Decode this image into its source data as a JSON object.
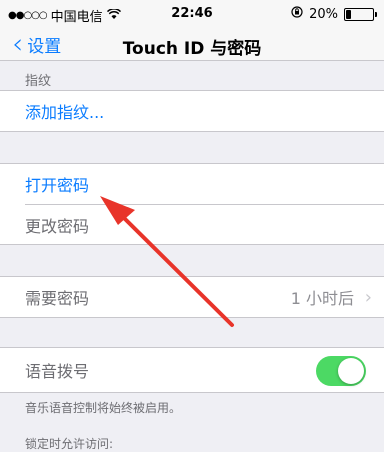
{
  "status_bar": {
    "signal": "●●○○○",
    "carrier": "中国电信",
    "wifi_icon": "wifi-icon",
    "time": "22:46",
    "battery": "20%",
    "battery_level": 0.2
  },
  "nav": {
    "back_label": "设置",
    "title": "Touch ID 与密码"
  },
  "sections": {
    "fingerprint_header": "指纹",
    "add_fingerprint": "添加指纹...",
    "turn_on_passcode": "打开密码",
    "change_passcode": "更改密码",
    "require_passcode": "需要密码",
    "require_passcode_value": "1 小时后",
    "voice_dial": "语音拨号",
    "voice_dial_on": true,
    "voice_dial_footer": "音乐语音控制将始终被启用。",
    "locked_access_header": "锁定时允许访问:"
  },
  "colors": {
    "accent": "#0a7cff",
    "toggle_on": "#4cd964",
    "annotation_arrow": "#e8342a"
  }
}
